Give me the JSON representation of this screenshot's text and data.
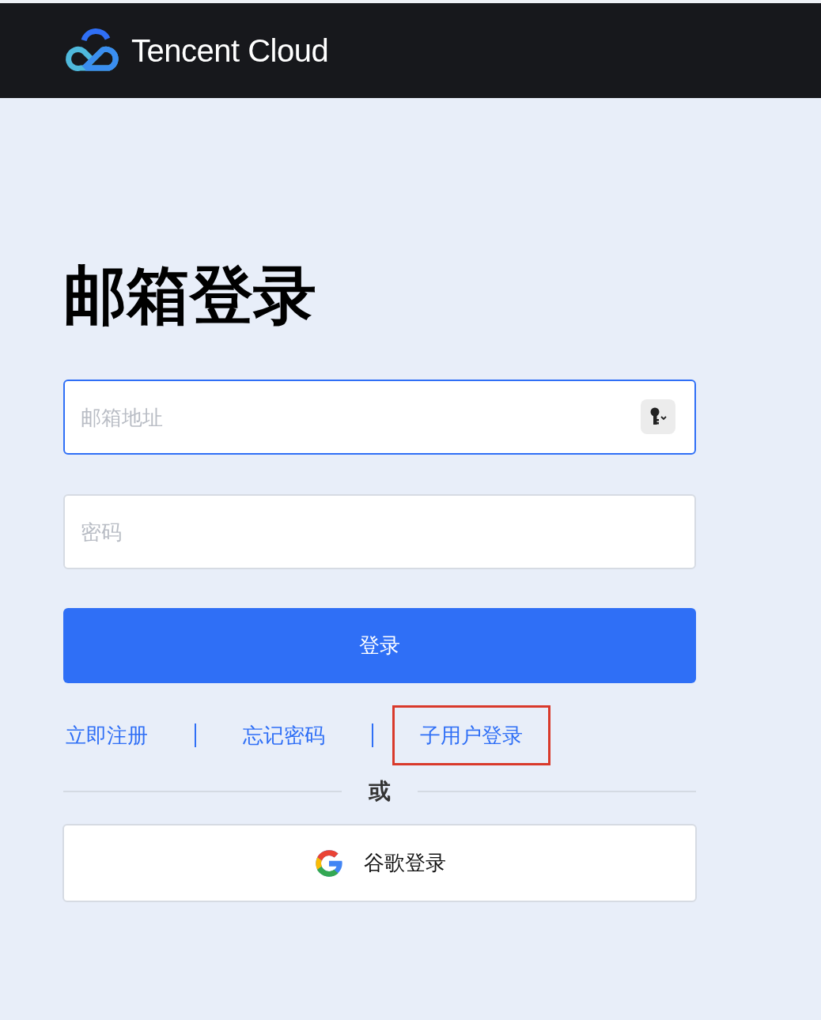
{
  "header": {
    "logo_text": "Tencent Cloud"
  },
  "title": "邮箱登录",
  "fields": [
    {
      "placeholder": "邮箱地址",
      "focused": true,
      "key_button": true
    },
    {
      "placeholder": "密码",
      "focused": false,
      "key_button": false
    }
  ],
  "login_button": "登录",
  "links": [
    {
      "label": "立即注册",
      "highlighted": false
    },
    {
      "label": "忘记密码",
      "highlighted": false
    },
    {
      "label": "子用户登录",
      "highlighted": true
    }
  ],
  "divider": "或",
  "google_button": "谷歌登录"
}
